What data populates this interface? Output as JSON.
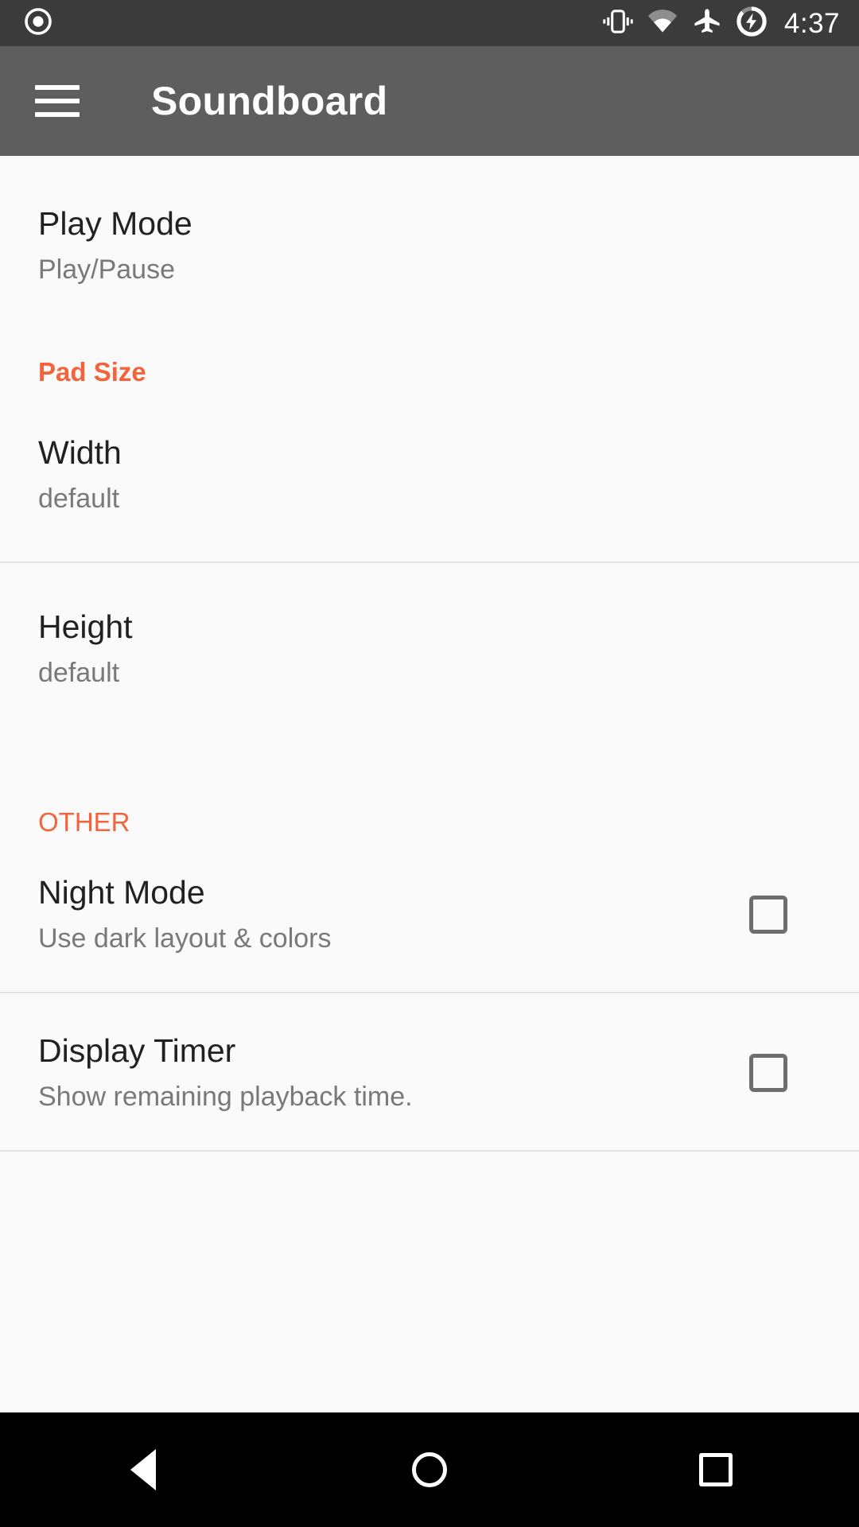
{
  "status_bar": {
    "left_icons": [
      {
        "name": "screen-record-icon",
        "glyph": "record"
      }
    ],
    "right_icons": [
      {
        "name": "vibrate-icon",
        "glyph": "vibrate"
      },
      {
        "name": "wifi-icon",
        "glyph": "wifi"
      },
      {
        "name": "airplane-mode-icon",
        "glyph": "airplane"
      },
      {
        "name": "battery-charging-icon",
        "glyph": "battery-charging"
      }
    ],
    "time": "4:37",
    "background_color": "#3b3b3b",
    "icon_color": "#ffffff"
  },
  "app_bar": {
    "menu_icon": "hamburger-menu-icon",
    "title": "Soundboard",
    "background_color": "#5e5e5e",
    "title_color": "#ffffff"
  },
  "theme": {
    "accent_color": "#f4643c",
    "page_background": "#fafafa",
    "primary_text": "#212121",
    "secondary_text": "#797979",
    "divider_color": "#e2e2e2",
    "checkbox_border": "#6e6e6e"
  },
  "settings": {
    "play_mode": {
      "title": "Play Mode",
      "summary": "Play/Pause"
    },
    "pad_size_header": "Pad Size",
    "width": {
      "title": "Width",
      "summary": "default"
    },
    "height": {
      "title": "Height",
      "summary": "default"
    },
    "other_header": "OTHER",
    "night_mode": {
      "title": "Night Mode",
      "summary": "Use dark layout & colors",
      "checked": false
    },
    "display_timer": {
      "title": "Display Timer",
      "summary": "Show remaining playback time.",
      "checked": false
    }
  },
  "nav_bar": {
    "back_label": "Back",
    "home_label": "Home",
    "recents_label": "Recents",
    "background_color": "#000000"
  }
}
